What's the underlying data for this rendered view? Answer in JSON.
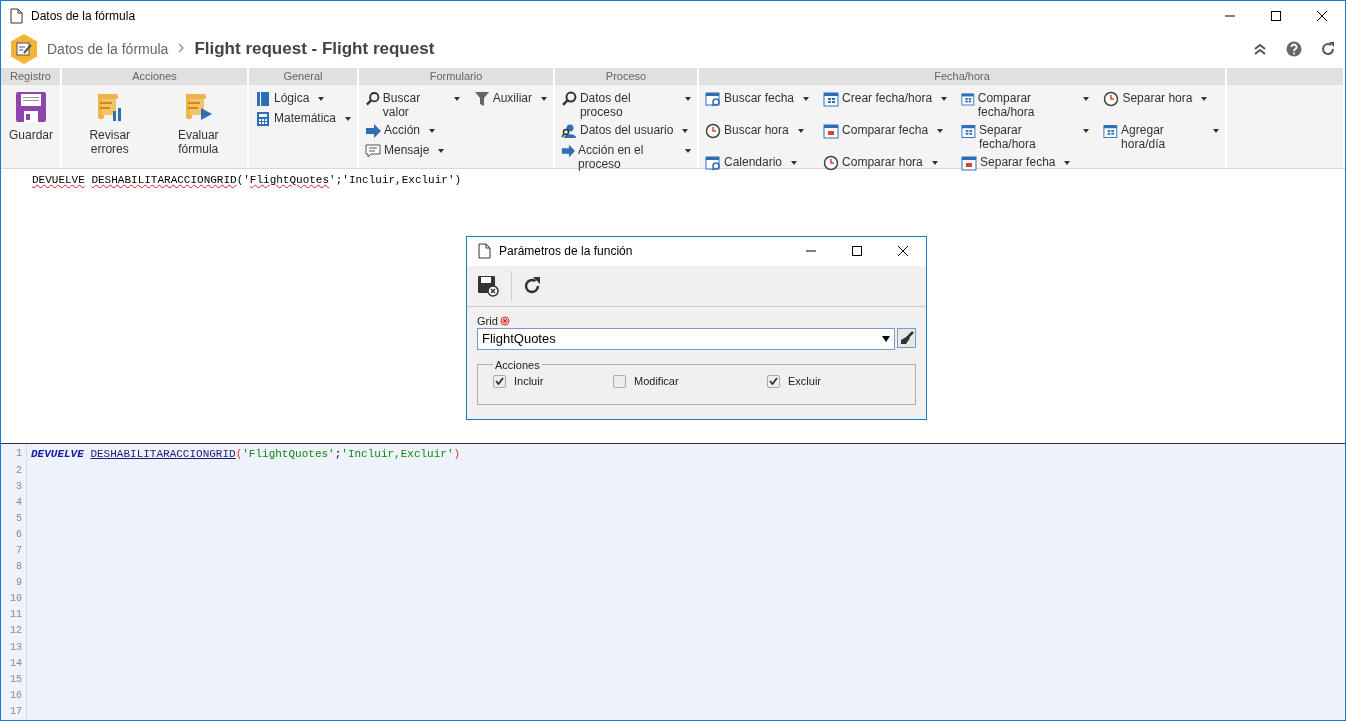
{
  "window": {
    "title": "Datos de la fórmula"
  },
  "header": {
    "breadcrumb": "Datos de la fórmula",
    "title": "Flight request - Flight request"
  },
  "ribbon": [
    {
      "title": "Registro",
      "kind": "large",
      "items": [
        {
          "label": "Guardar",
          "kind": "disk"
        }
      ]
    },
    {
      "title": "Acciones",
      "kind": "large",
      "items": [
        {
          "label": "Revisar errores",
          "kind": "scroll-chart"
        },
        {
          "label": "Evaluar fórmula",
          "kind": "scroll-play"
        }
      ]
    },
    {
      "title": "General",
      "kind": "small",
      "items": [
        {
          "label": "Lógica",
          "kind": "book",
          "dropdown": true
        },
        {
          "label": "Matemática",
          "kind": "calculator",
          "dropdown": true
        }
      ]
    },
    {
      "title": "Formulario",
      "kind": "small",
      "items": [
        {
          "label": "Buscar valor",
          "kind": "search",
          "dropdown": true
        },
        {
          "label": "Acción",
          "kind": "arrow",
          "dropdown": true
        },
        {
          "label": "Mensaje",
          "kind": "message",
          "dropdown": true
        },
        {
          "label": "Auxiliar",
          "kind": "filter",
          "dropdown": true
        }
      ]
    },
    {
      "title": "Proceso",
      "kind": "small",
      "items": [
        {
          "label": "Datos del proceso",
          "kind": "search",
          "dropdown": true
        },
        {
          "label": "Datos del usuario",
          "kind": "user",
          "dropdown": true
        },
        {
          "label": "Acción en el proceso",
          "kind": "arrow",
          "dropdown": true
        }
      ]
    },
    {
      "title": "Fecha/hora",
      "kind": "small",
      "items": [
        {
          "label": "Buscar fecha",
          "kind": "calendar-search",
          "dropdown": true
        },
        {
          "label": "Buscar hora",
          "kind": "clock",
          "dropdown": true
        },
        {
          "label": "Calendario",
          "kind": "calendar-search",
          "dropdown": true
        },
        {
          "label": "Crear fecha/hora",
          "kind": "calendar",
          "dropdown": true
        },
        {
          "label": "Comparar fecha",
          "kind": "calendar-red",
          "dropdown": true
        },
        {
          "label": "Comparar hora",
          "kind": "clock",
          "dropdown": true
        },
        {
          "label": "Comparar fecha/hora",
          "kind": "calendar",
          "dropdown": true
        },
        {
          "label": "Separar fecha/hora",
          "kind": "calendar",
          "dropdown": true
        },
        {
          "label": "Separar fecha",
          "kind": "calendar-red",
          "dropdown": true
        },
        {
          "label": "Separar hora",
          "kind": "clock",
          "dropdown": true
        },
        {
          "label": "Agregar hora/día",
          "kind": "calendar",
          "dropdown": true
        }
      ]
    }
  ],
  "formula_preview": [
    {
      "kind": "word",
      "text": "DEVUELVE",
      "misspelled": true
    },
    {
      "kind": "space"
    },
    {
      "kind": "word",
      "text": "DESHABILITARACCIONGRID",
      "misspelled": true
    },
    {
      "kind": "word",
      "text": "('",
      "misspelled": false
    },
    {
      "kind": "word",
      "text": "FlightQuotes",
      "misspelled": true
    },
    {
      "kind": "word",
      "text": "';'Incluir,Excluir')",
      "misspelled": false
    }
  ],
  "dialog": {
    "title": "Parámetros de la función",
    "field": {
      "label": "Grid",
      "required": true,
      "value": "FlightQuotes"
    },
    "group": "Acciones",
    "options": [
      {
        "label": "Incluir",
        "checked": true
      },
      {
        "label": "Modificar",
        "checked": false
      },
      {
        "label": "Excluir",
        "checked": true
      }
    ]
  },
  "editor": {
    "line_numbers": [
      "1",
      "2",
      "3",
      "4",
      "5",
      "6",
      "7",
      "8",
      "9",
      "10",
      "11",
      "12",
      "13",
      "14",
      "15",
      "16",
      "17"
    ],
    "lines": [
      [
        {
          "kind": "keyword",
          "text": "DEVUELVE"
        },
        {
          "kind": "space"
        },
        {
          "kind": "function",
          "text": "DESHABILITARACCIONGRID"
        },
        {
          "kind": "paren",
          "text": "("
        },
        {
          "kind": "string",
          "text": "'FlightQuotes'"
        },
        {
          "kind": "plain",
          "text": ";"
        },
        {
          "kind": "string",
          "text": "'Incluir,Excluir'"
        },
        {
          "kind": "paren",
          "text": ")"
        }
      ]
    ]
  }
}
